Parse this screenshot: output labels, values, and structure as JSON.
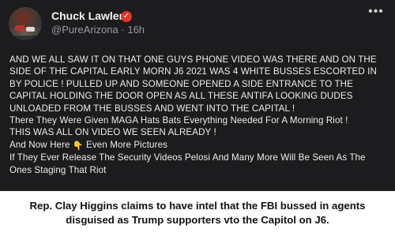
{
  "post": {
    "author_name": "Chuck Lawler",
    "handle": "@PureArizona",
    "separator": "·",
    "time_ago": "16h",
    "more_label": "•••",
    "verified_symbol": "✓",
    "lines": [
      "AND WE ALL SAW IT ON THAT ONE GUYS PHONE VIDEO WAS THERE AND ON THE",
      "SIDE OF THE CAPITAL EARLY MORN J6 2021 WAS 4 WHITE BUSSES ESCORTED IN",
      "BY POLICE ! PULLED UP AND SOMEONE OPENED A SIDE ENTRANCE TO THE",
      "CAPITAL HOLDING THE DOOR OPEN AS ALL THESE ANTIFA LOOKING DUDES",
      "UNLOADED FROM THE BUSSES AND WENT INTO THE CAPITAL !",
      "There They Were Given MAGA Hats Bats Everything Needed For A Morning Riot !",
      "THIS WAS ALL ON VIDEO WE SEEN ALREADY !"
    ],
    "and_now_before": "And Now Here",
    "and_now_emoji": "👇",
    "and_now_after": "Even More Pictures",
    "closing_lines": [
      "If They Ever Release The Security Videos Pelosi And Many More Will Be Seen As The",
      "Ones Staging That Riot"
    ]
  },
  "caption": {
    "line1": "Rep. Clay Higgins claims to have intel that the FBI bussed in agents",
    "line2": "disguised as Trump supporters vto the Capitol on J6."
  },
  "colors": {
    "card_background": "#1c1c1e",
    "verified_badge": "#e0362b",
    "caption_text": "#111111"
  }
}
